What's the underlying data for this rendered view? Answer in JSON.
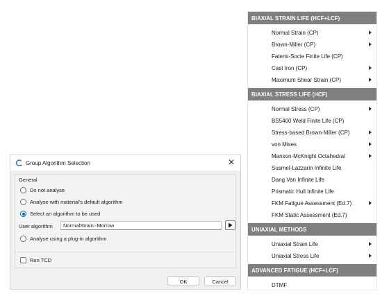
{
  "dialog": {
    "title": "Group Algorithm Selection",
    "close_glyph": "✕",
    "general_label": "General",
    "options": [
      {
        "label": "Do not analyse",
        "checked": false
      },
      {
        "label": "Analyse with material's default algorithm",
        "checked": false
      },
      {
        "label": "Select an algorithm to be used",
        "checked": true
      }
    ],
    "user_algorithm_label": "User algorithm",
    "user_algorithm_value": "NormalStrain:-Morrow",
    "plugin_option": {
      "label": "Analyse using a plug-in algorithm",
      "checked": false
    },
    "run_tcd_label": "Run TCD",
    "run_tcd_checked": false,
    "ok_label": "OK",
    "cancel_label": "Cancel",
    "icons": {
      "title": "app-icon",
      "run": "play-icon"
    }
  },
  "menu": {
    "header_color": "#7f7f7f",
    "sections": [
      {
        "header": "BIAXIAL STRAIN LIFE (HCF+LCF)",
        "items": [
          {
            "label": "Normal Strain (CP)",
            "submenu": true
          },
          {
            "label": "Brown-Miller (CP)",
            "submenu": true
          },
          {
            "label": "Fatemi-Socie Finite Life (CP)",
            "submenu": false
          },
          {
            "label": "Cast Iron (CP)",
            "submenu": true
          },
          {
            "label": "Maximum Shear Strain (CP)",
            "submenu": true
          }
        ]
      },
      {
        "header": "BIAXIAL STRESS LIFE (HCF)",
        "items": [
          {
            "label": "Normal Stress (CP)",
            "submenu": true
          },
          {
            "label": "BS5400 Weld Finite Life (CP)",
            "submenu": false
          },
          {
            "label": "Stress-based Brown-Miller (CP)",
            "submenu": true
          },
          {
            "label": "von Mises",
            "submenu": true
          },
          {
            "label": "Manson-McKnight Octahedral",
            "submenu": true
          },
          {
            "label": "Susmel-Lazzarin Infinite Life",
            "submenu": false
          },
          {
            "label": "Dang Van Infinite Life",
            "submenu": false
          },
          {
            "label": "Prismatic Hull Infinite Life",
            "submenu": false
          },
          {
            "label": "FKM Fatigue Assessment (Ed.7)",
            "submenu": true
          },
          {
            "label": "FKM Static Assessment (Ed.7)",
            "submenu": false
          }
        ]
      },
      {
        "header": "UNIAXIAL METHODS",
        "items": [
          {
            "label": "Uniaxial Strain Life",
            "submenu": true
          },
          {
            "label": "Uniaxial Stress Life",
            "submenu": true
          }
        ]
      },
      {
        "header": "ADVANCED FATIGUE (HCF+LCF)",
        "items": [
          {
            "label": "DTMF",
            "submenu": false
          }
        ]
      }
    ]
  }
}
